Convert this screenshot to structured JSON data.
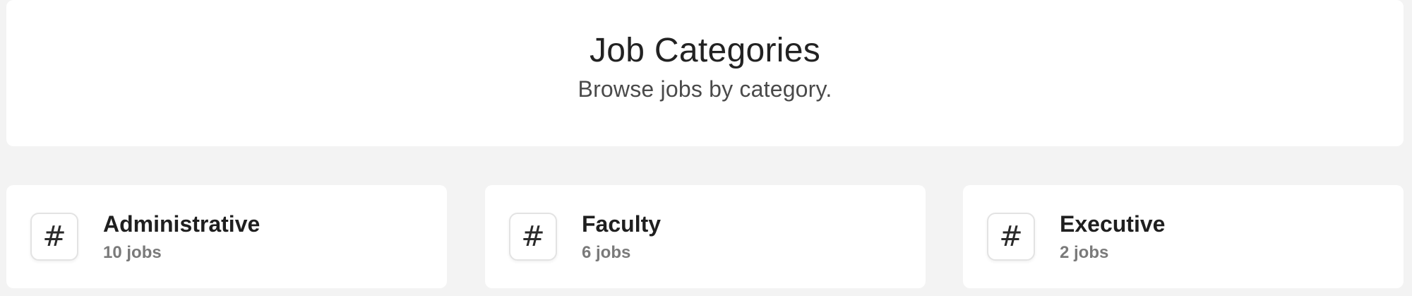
{
  "header": {
    "title": "Job Categories",
    "subtitle": "Browse jobs by category."
  },
  "categories": [
    {
      "icon": "hash-icon",
      "glyph": "#",
      "name": "Administrative",
      "count": "10 jobs"
    },
    {
      "icon": "hash-icon",
      "glyph": "#",
      "name": "Faculty",
      "count": "6 jobs"
    },
    {
      "icon": "hash-icon",
      "glyph": "#",
      "name": "Executive",
      "count": "2 jobs"
    }
  ],
  "colors": {
    "background": "#f3f3f3",
    "card": "#ffffff",
    "text_primary": "#1f1f1f",
    "text_secondary": "#7a7a7a"
  }
}
